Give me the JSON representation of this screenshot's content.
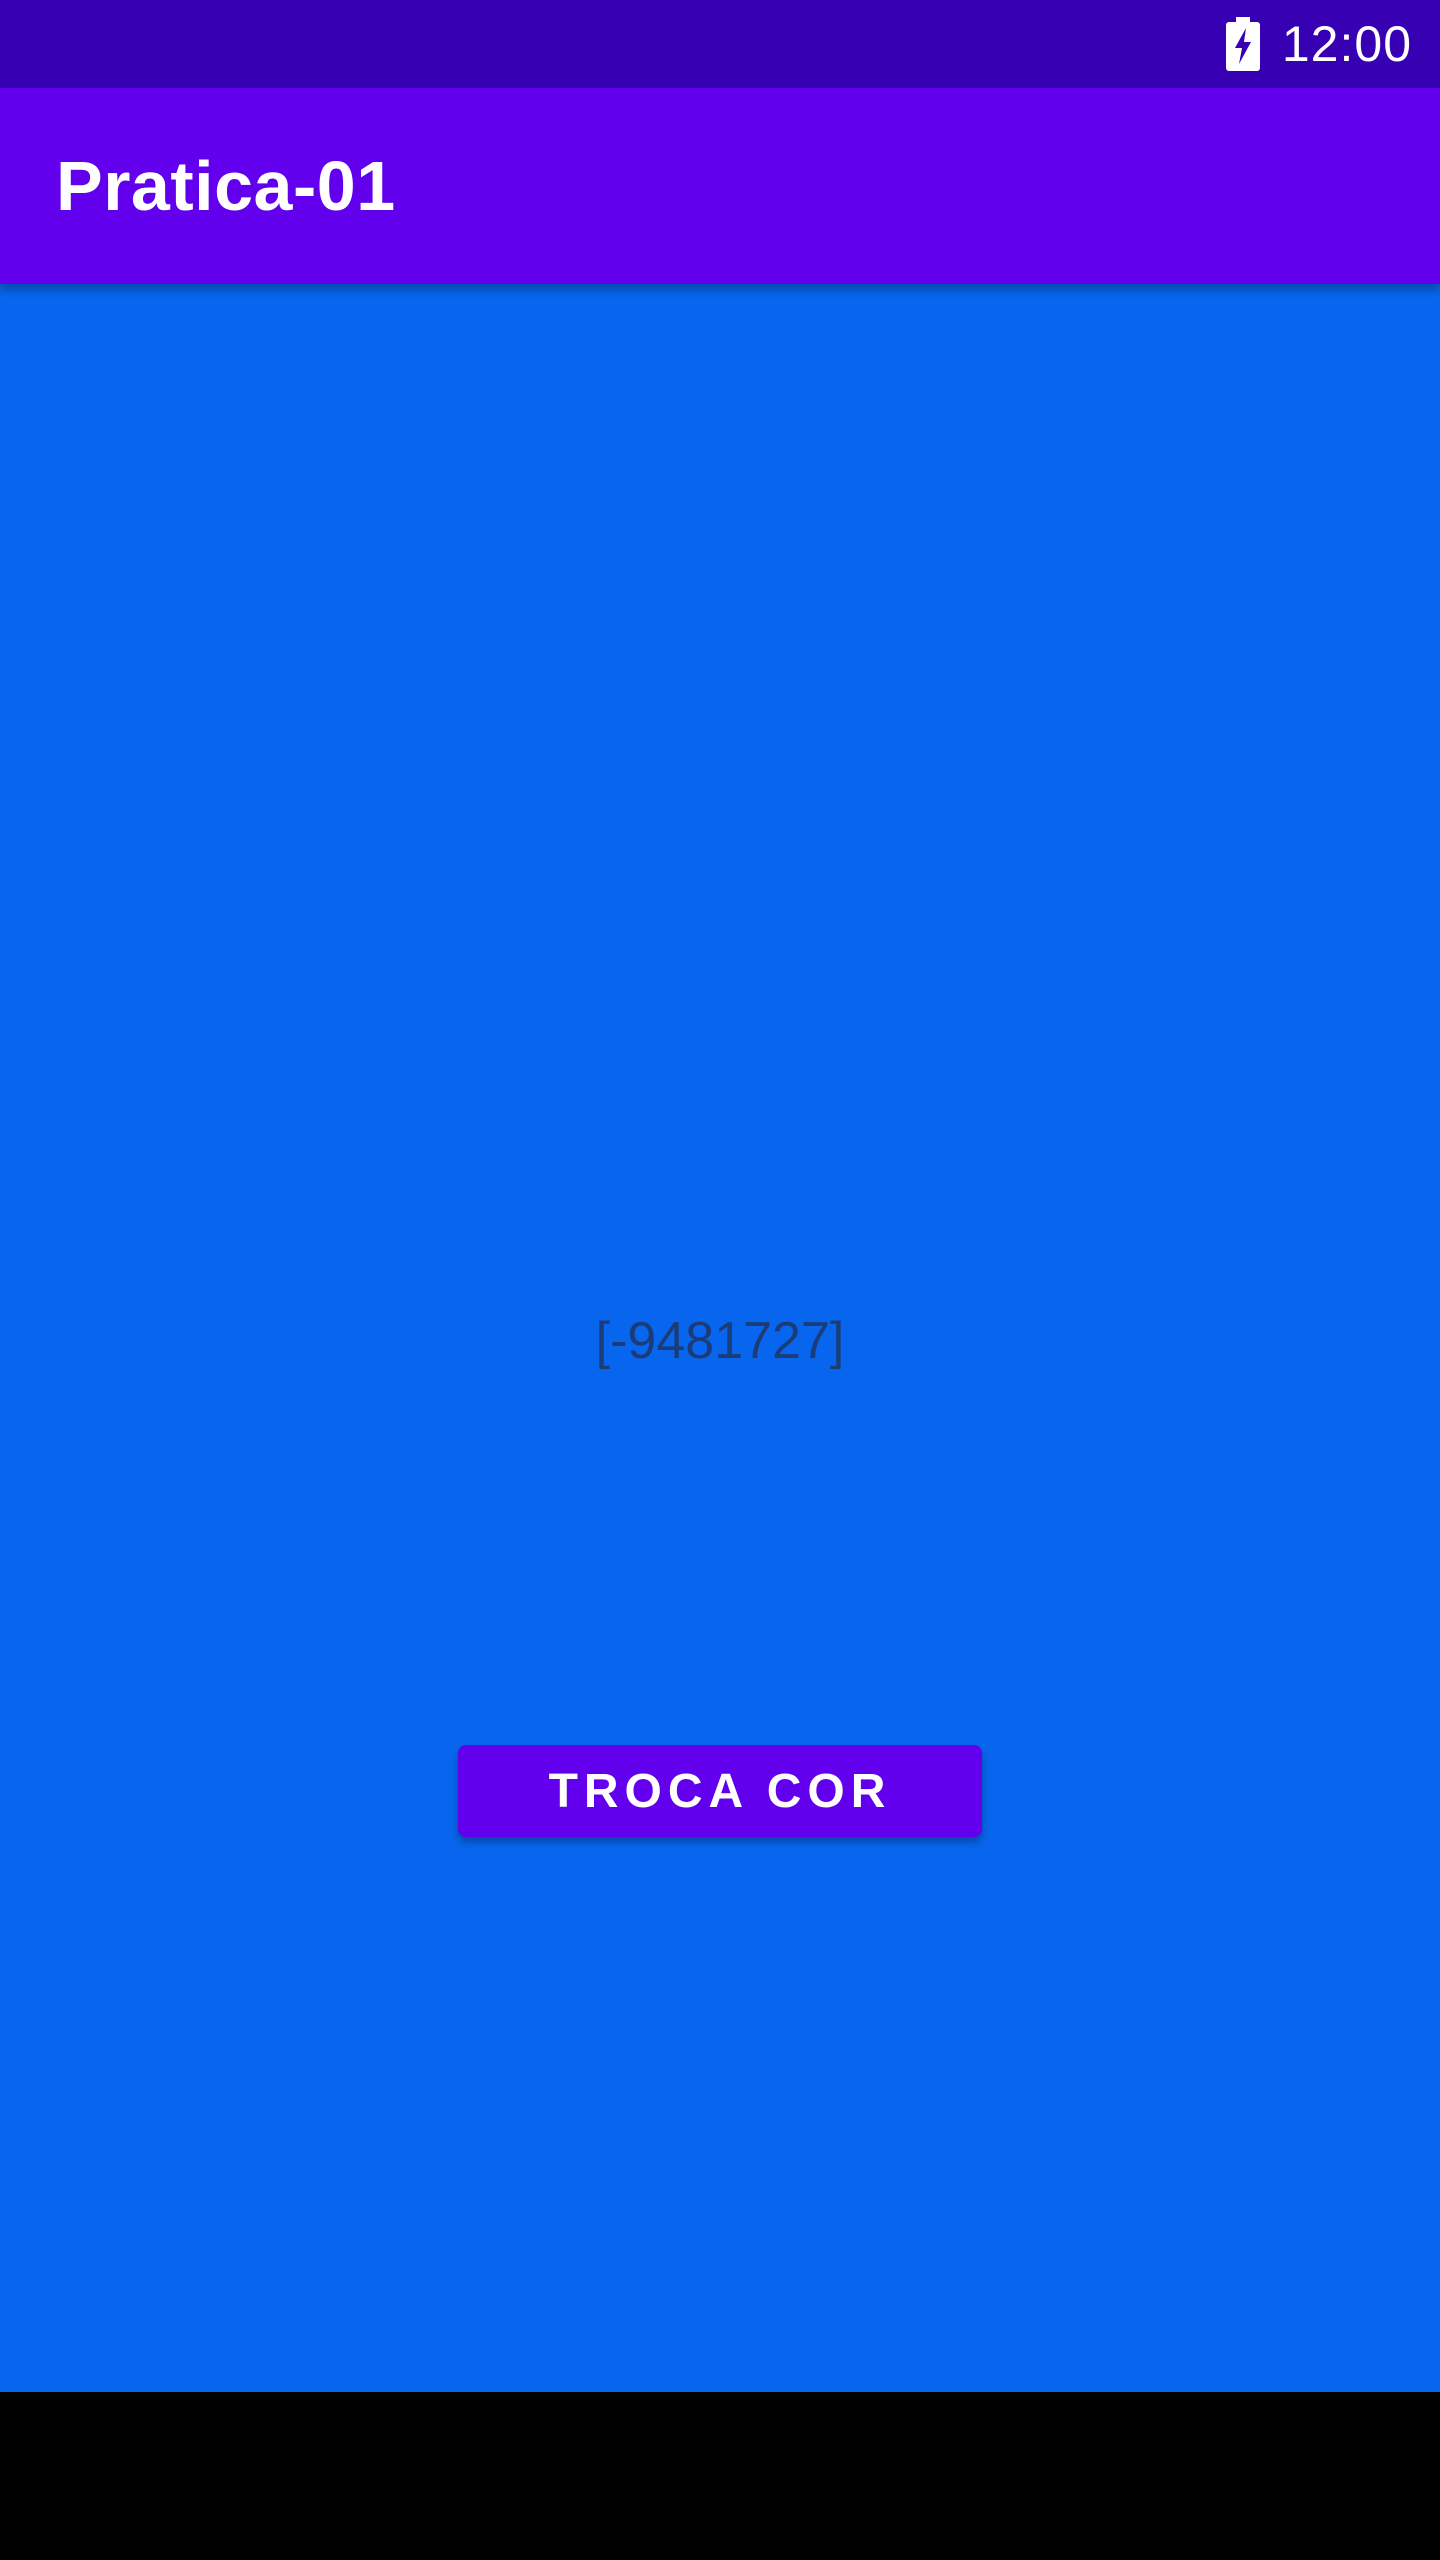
{
  "status_bar": {
    "time": "12:00",
    "icons": [
      "battery-charging-icon"
    ]
  },
  "app_bar": {
    "title": "Pratica-01"
  },
  "main": {
    "color_value": "[-9481727]",
    "button_label": "TROCA COR"
  },
  "colors": {
    "status_bar": "#3700B3",
    "app_bar": "#6200EE",
    "background": "#0866EE",
    "button": "#6200EE",
    "value_text": "#1B3C78",
    "nav_bar": "#000000"
  }
}
